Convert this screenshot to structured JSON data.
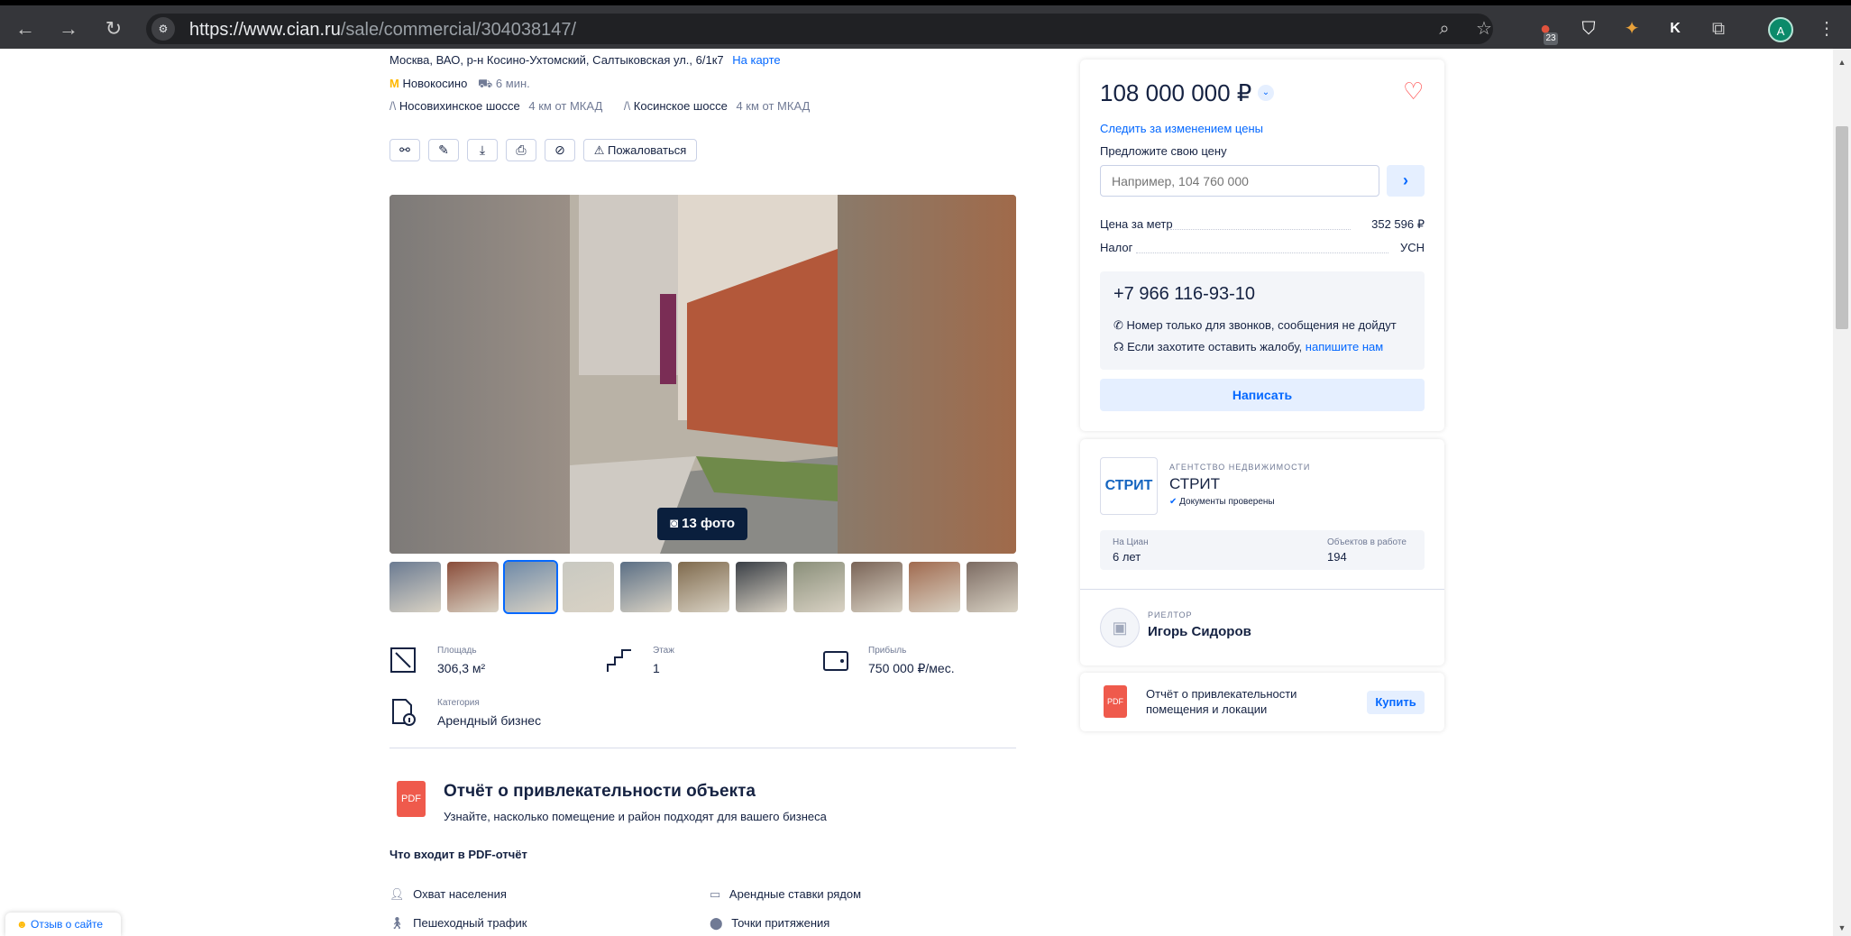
{
  "browser": {
    "url_host": "https://www.cian.ru",
    "url_path": "/sale/commercial/304038147/",
    "extension_badge": "23",
    "extension_k": "K",
    "profile_letter": "A"
  },
  "address": {
    "text": "Москва, ВАО, р-н Косино-Ухтомский, Салтыковская ул., 6/1к7",
    "map_link": "На карте"
  },
  "metro": {
    "station": "Новокосино",
    "time": "6 мин."
  },
  "highways": [
    {
      "name": "Носовихинское шоссе",
      "distance": "4 км от МКАД"
    },
    {
      "name": "Косинское шоссе",
      "distance": "4 км от МКАД"
    }
  ],
  "toolbar": {
    "complain_label": "Пожаловаться"
  },
  "gallery": {
    "photos_label": "13 фото",
    "thumbs": [
      "#6b7b92",
      "#8a4d3a",
      "#6f8aa8",
      "#c9c9c2",
      "#5b6f85",
      "#7f6a4d",
      "#3a3f46",
      "#8a8f7a",
      "#7a6457",
      "#a06a4f",
      "#7c6b62"
    ]
  },
  "features": {
    "area_label": "Площадь",
    "area_value": "306,3 м²",
    "floor_label": "Этаж",
    "floor_value": "1",
    "profit_label": "Прибыль",
    "profit_value": "750 000 ₽/мес.",
    "category_label": "Категория",
    "category_value": "Арендный бизнес"
  },
  "report": {
    "pdf_badge": "PDF",
    "title": "Отчёт о привлекательности объекта",
    "subtitle": "Узнайте, насколько помещение и район подходят для вашего бизнеса",
    "includes_title": "Что входит в PDF-отчёт",
    "items": [
      "Охват населения",
      "Арендные ставки рядом",
      "Пешеходный трафик",
      "Точки притяжения"
    ]
  },
  "price_card": {
    "price": "108 000 000 ₽",
    "follow_link": "Следить за изменением цены",
    "offer_label": "Предложите свою цену",
    "offer_placeholder": "Например, 104 760 000",
    "price_per_meter_label": "Цена за метр",
    "price_per_meter_value": "352 596 ₽",
    "tax_label": "Налог",
    "tax_value": "УСН",
    "phone": "+7 966 116-93-10",
    "note_calls": "Номер только для звонков, сообщения не дойдут",
    "note_complaint": "Если захотите оставить жалобу,",
    "note_complaint_link": "напишите нам",
    "write_button": "Написать"
  },
  "agency_card": {
    "logo_text": "СТРИТ",
    "type_label": "АГЕНТСТВО НЕДВИЖИМОСТИ",
    "name": "СТРИТ",
    "verified": "Документы проверены",
    "on_cian_label": "На Циан",
    "on_cian_value": "6 лет",
    "objects_label": "Объектов в работе",
    "objects_value": "194",
    "realtor_label": "РИЕЛТОР",
    "realtor_name": "Игорь Сидоров"
  },
  "report_card": {
    "pdf_badge": "PDF",
    "line1": "Отчёт о привлекательности",
    "line2": "помещения и локации",
    "buy_button": "Купить"
  },
  "feedback": {
    "label": "Отзыв о сайте"
  },
  "colors": {
    "accent": "#0468ff",
    "text": "#152242",
    "muted": "#707a95",
    "pdf_red": "#ef5a4c",
    "heart": "#ff5050"
  }
}
